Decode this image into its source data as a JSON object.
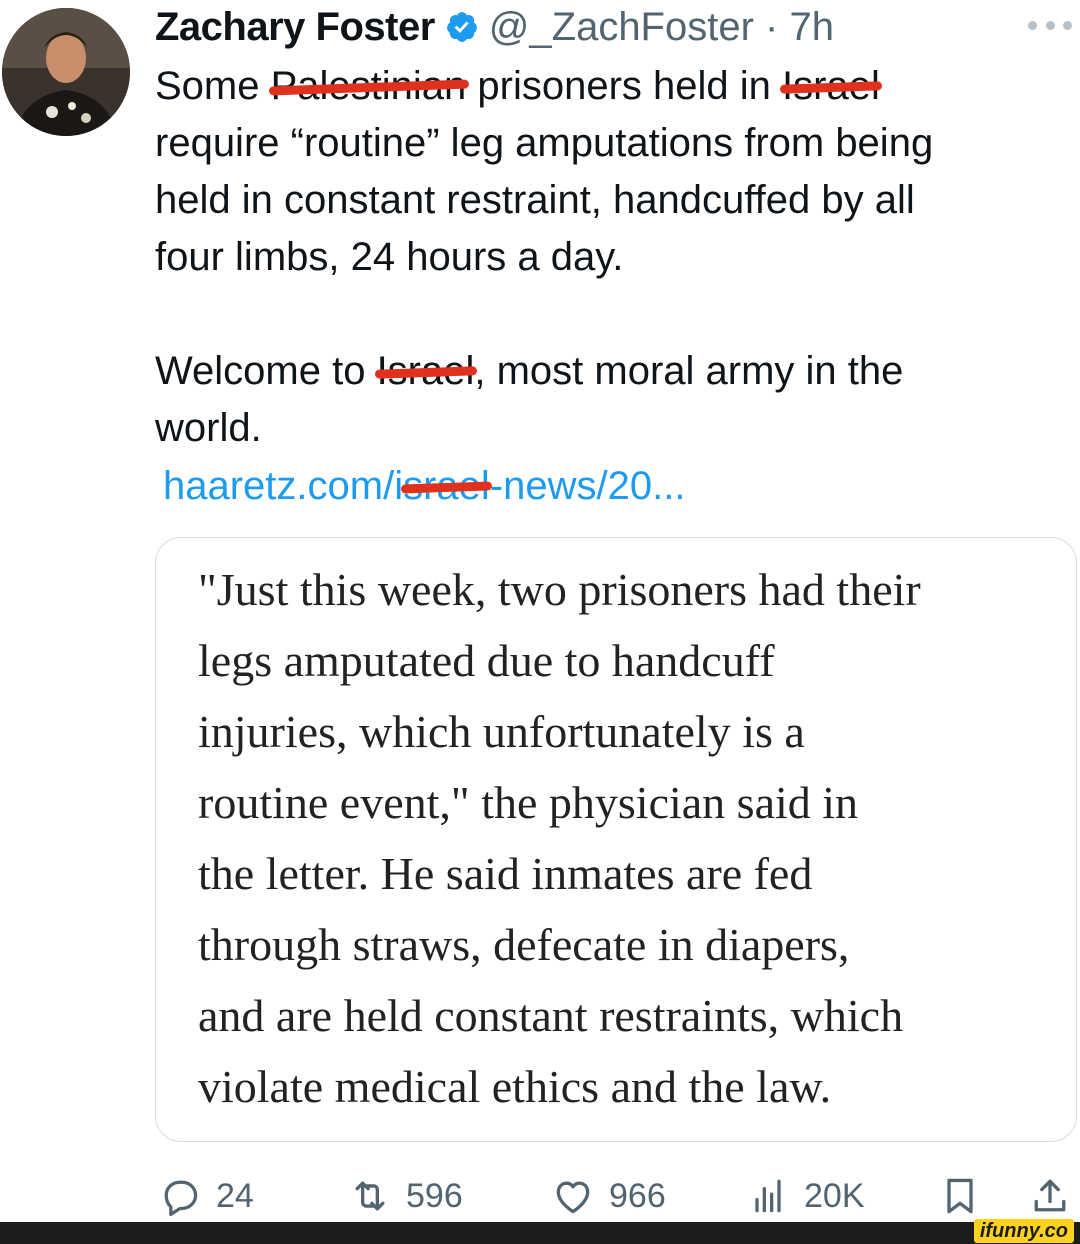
{
  "tweet": {
    "author_name": "Zachary Foster",
    "handle_time": "@_ZachFoster · 7h",
    "text": {
      "l1_a": "Some ",
      "l1_redacted": "Palestinian",
      "l1_b": " prisoners held in ",
      "l1_redacted2": "Israel",
      "l2": "require “routine” leg amputations from being",
      "l3": "held in constant restraint, handcuffed by all",
      "l4": "four limbs, 24 hours a day.",
      "l5_a": "Welcome to ",
      "l5_redacted": "Israel",
      "l5_b": ", most moral army in the",
      "l6": "world."
    },
    "link": {
      "a": "haaretz.com/i",
      "redacted": "srael",
      "b": "-news/20..."
    }
  },
  "quote_card": {
    "lines": [
      "\"Just this week, two prisoners had their",
      "legs amputated due to handcuff",
      "injuries, which unfortunately is a",
      "routine event,\" the physician said in",
      "the letter. He said inmates are fed",
      "through straws, defecate in diapers,",
      "and are held constant restraints, which",
      "violate medical ethics and the law."
    ]
  },
  "actions": {
    "replies": "24",
    "retweets": "596",
    "likes": "966",
    "views": "20K"
  },
  "watermark": "ifunny.co",
  "colors": {
    "link": "#1d9bf0",
    "verified_badge": "#1d9bf0",
    "redaction": "#e0301e",
    "secondary_text": "#536471",
    "watermark_bar": "#1c1c1c"
  },
  "icons": [
    "verified-badge-icon",
    "more-icon",
    "reply-icon",
    "retweet-icon",
    "like-icon",
    "views-icon",
    "bookmark-icon",
    "share-icon"
  ]
}
